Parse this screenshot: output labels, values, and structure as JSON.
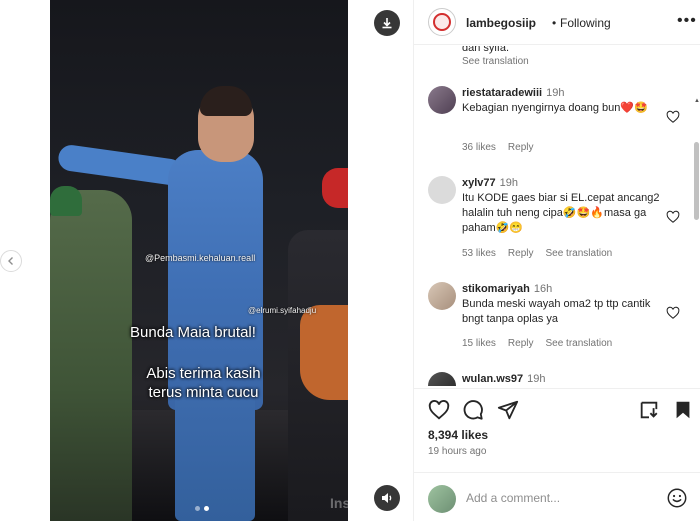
{
  "post": {
    "username": "lambegosiip",
    "separator": "•",
    "follow_status": "Following",
    "more_label": "•••",
    "likes": "8,394 likes",
    "posted_ago": "19 hours ago"
  },
  "video": {
    "watermark_1": "@Pembasmi.kehaluan.reall",
    "watermark_2": "@elrumi.syifahadju",
    "caption_line_1": "Bunda Maia brutal!",
    "caption_line_2": "Abis terima kasih terus minta cucu",
    "brand_watermark": "Insta",
    "slide_count": 2,
    "active_slide": 2
  },
  "comments_partial": {
    "text": "dan syifa.",
    "see_translation": "See translation"
  },
  "comments": [
    {
      "user": "riestataradewiii",
      "time": "19h",
      "text": "Kebagian nyengirnya doang bun❤️🤩",
      "likes": "36 likes",
      "reply": "Reply",
      "translation": "",
      "avatar_color": "#6b5a6e"
    },
    {
      "user": "xylv77",
      "time": "19h",
      "text": "Itu KODE gaes biar si EL.cepat ancang2 halalin tuh neng cipa🤣🤩🔥masa ga paham🤣😁",
      "likes": "53 likes",
      "reply": "Reply",
      "translation": "See translation",
      "avatar_color": "#d9d9d9"
    },
    {
      "user": "stikomariyah",
      "time": "16h",
      "text": "Bunda meski wayah oma2 tp ttp cantik bngt tanpa oplas ya",
      "likes": "15 likes",
      "reply": "Reply",
      "translation": "See translation",
      "avatar_color": "#c9b8a8"
    },
    {
      "user": "wulan.ws97",
      "time": "19h",
      "text": "",
      "likes": "",
      "reply": "",
      "translation": "",
      "avatar_color": "#3a3a3a"
    }
  ],
  "add_comment": {
    "placeholder": "Add a comment..."
  },
  "icons": {
    "download": "download-icon",
    "sound": "speaker-icon",
    "prev": "chevron-left-icon",
    "like": "heart-icon",
    "comment": "comment-icon",
    "share": "send-icon",
    "save": "bookmark-icon",
    "emoji": "smile-icon"
  }
}
